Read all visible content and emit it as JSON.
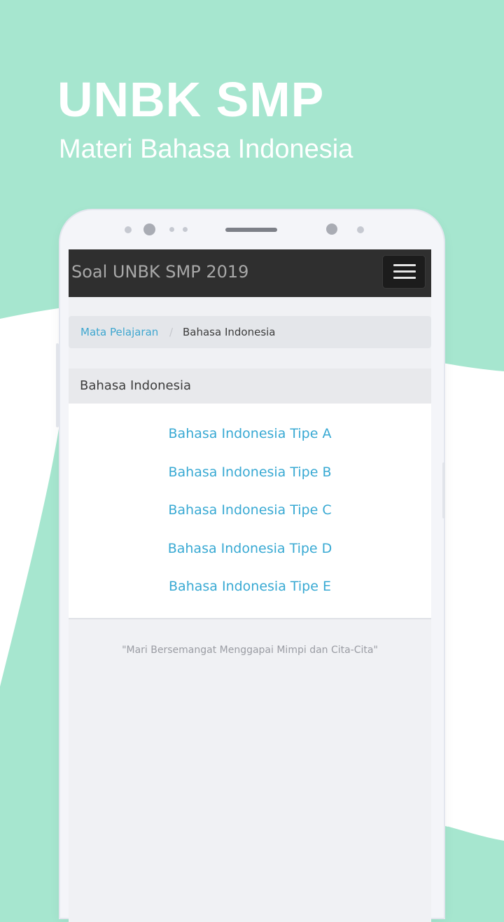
{
  "promo": {
    "title": "UNBK SMP",
    "subtitle": "Materi Bahasa Indonesia"
  },
  "colors": {
    "background": "#a6e6cf",
    "navbar": "#2f2f2f",
    "link": "#38a9d3"
  },
  "app": {
    "brand": "Soal UNBK SMP 2019",
    "menu_icon": "hamburger-menu-icon"
  },
  "breadcrumb": {
    "items": [
      {
        "label": "Mata Pelajaran"
      },
      {
        "label": "Bahasa Indonesia"
      }
    ],
    "separator": "/"
  },
  "panel": {
    "heading": "Bahasa Indonesia",
    "links": [
      {
        "label": "Bahasa Indonesia Tipe A"
      },
      {
        "label": "Bahasa Indonesia Tipe B"
      },
      {
        "label": "Bahasa Indonesia Tipe C"
      },
      {
        "label": "Bahasa Indonesia Tipe D"
      },
      {
        "label": "Bahasa Indonesia Tipe E"
      }
    ]
  },
  "footer": {
    "quote": "\"Mari Bersemangat Menggapai Mimpi dan Cita-Cita\""
  }
}
